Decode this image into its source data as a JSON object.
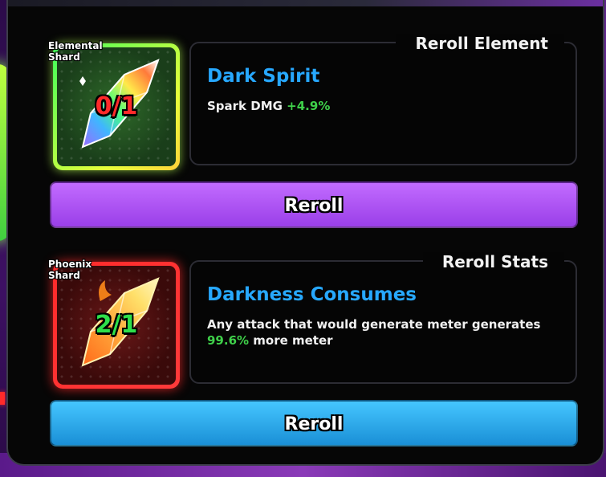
{
  "sections": [
    {
      "shard_name": "Elemental Shard",
      "shard_count": "0/1",
      "header": "Reroll Element",
      "title": "Dark Spirit",
      "desc_text": "Spark DMG ",
      "desc_highlight": "+4.9%",
      "desc_after": "",
      "button": "Reroll"
    },
    {
      "shard_name": "Phoenix Shard",
      "shard_count": "2/1",
      "header": "Reroll Stats",
      "title": "Darkness Consumes",
      "desc_text": "Any attack that would generate meter generates ",
      "desc_highlight": "99.6%",
      "desc_after": " more meter",
      "button": "Reroll"
    }
  ],
  "colors": {
    "title_blue": "#27a8ff",
    "stat_green": "#3fd14a",
    "button_purple": "#a24bf0",
    "button_blue": "#2aa6ea"
  },
  "icons": [
    "rainbow-crystal-icon",
    "phoenix-crystal-icon"
  ]
}
